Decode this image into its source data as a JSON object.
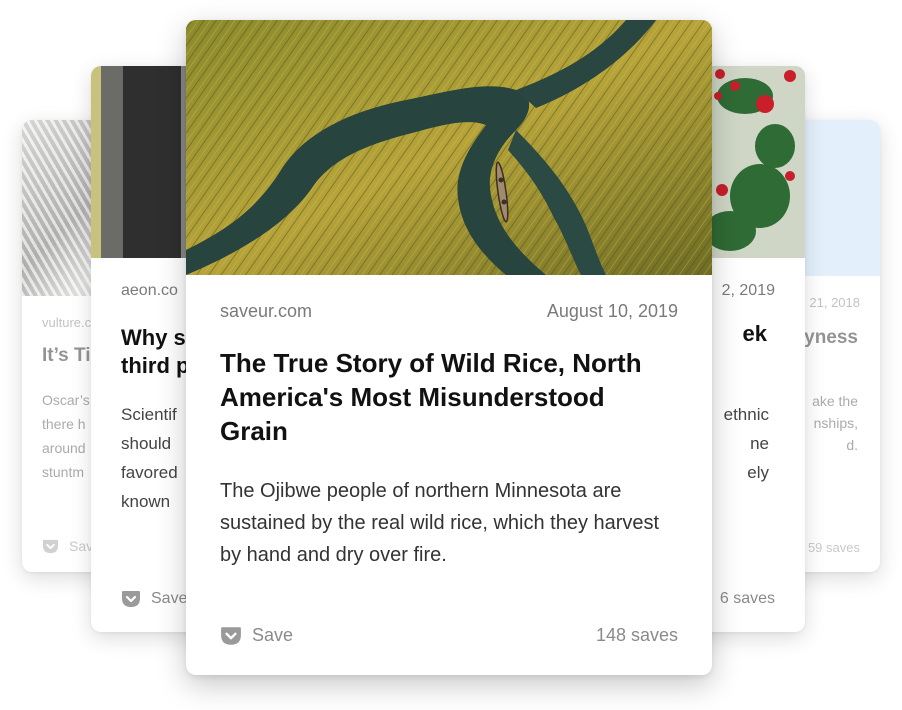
{
  "colors": {
    "pocket_icon": "#9a9a9a",
    "muted_text": "#8a8a8a",
    "title_text": "#111111"
  },
  "cards": [
    {
      "source": "vulture.c",
      "title": "It’s Ti",
      "excerpt": [
        "Oscar’s",
        "there h",
        "around",
        "stuntm"
      ],
      "save_label": "Save",
      "icon": "pocket-save-icon"
    },
    {
      "source": "aeon.co",
      "title": [
        "Why s",
        "third p"
      ],
      "excerpt": [
        "Scientif",
        "should",
        "favored",
        "known"
      ],
      "save_label": "Save",
      "icon": "pocket-save-icon"
    },
    {
      "source": "saveur.com",
      "date": "August 10, 2019",
      "title": "The True Story of Wild Rice, North America's Most Misunderstood Grain",
      "excerpt": "The Ojibwe people of northern Minnesota are sustained by the real wild rice, which they harvest by hand and dry over fire.",
      "save_label": "Save",
      "saves": "148 saves",
      "icon": "pocket-save-icon",
      "image": "aerial photo of a canoe in a wild rice marsh"
    },
    {
      "date": "2, 2019",
      "title": "ek",
      "excerpt": [
        "ethnic",
        "ne",
        "ely"
      ],
      "saves": "6 saves"
    },
    {
      "date": "21, 2018",
      "title": "yness",
      "excerpt": [
        "ake the",
        "nships,",
        "d."
      ],
      "saves": "59 saves"
    }
  ]
}
